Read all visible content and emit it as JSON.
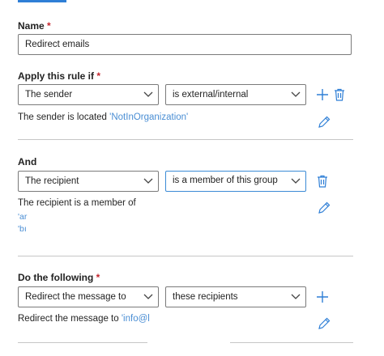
{
  "name_field": {
    "label": "Name",
    "required_mark": "*",
    "value": "Redirect emails"
  },
  "condition": {
    "label": "Apply this rule if",
    "required_mark": "*",
    "subject_select": "The sender",
    "operator_select": "is external/internal",
    "description_text": "The sender is located",
    "description_link": "'NotInOrganization'"
  },
  "and_condition": {
    "label": "And",
    "subject_select": "The recipient",
    "operator_select": "is a member of this group",
    "description_text": "The recipient is a member of",
    "group_links": [
      "'ar",
      "'bı"
    ]
  },
  "action": {
    "label": "Do the following",
    "required_mark": "*",
    "action_select": "Redirect the message to",
    "target_select": "these recipients",
    "description_text": "Redirect the message to",
    "description_link": "'info@l"
  },
  "colors": {
    "accent": "#2f7fd6",
    "link": "#4a8ed4",
    "required": "#c4262e"
  },
  "icons": [
    "add-icon",
    "delete-icon",
    "edit-icon",
    "chevron-down-icon"
  ]
}
